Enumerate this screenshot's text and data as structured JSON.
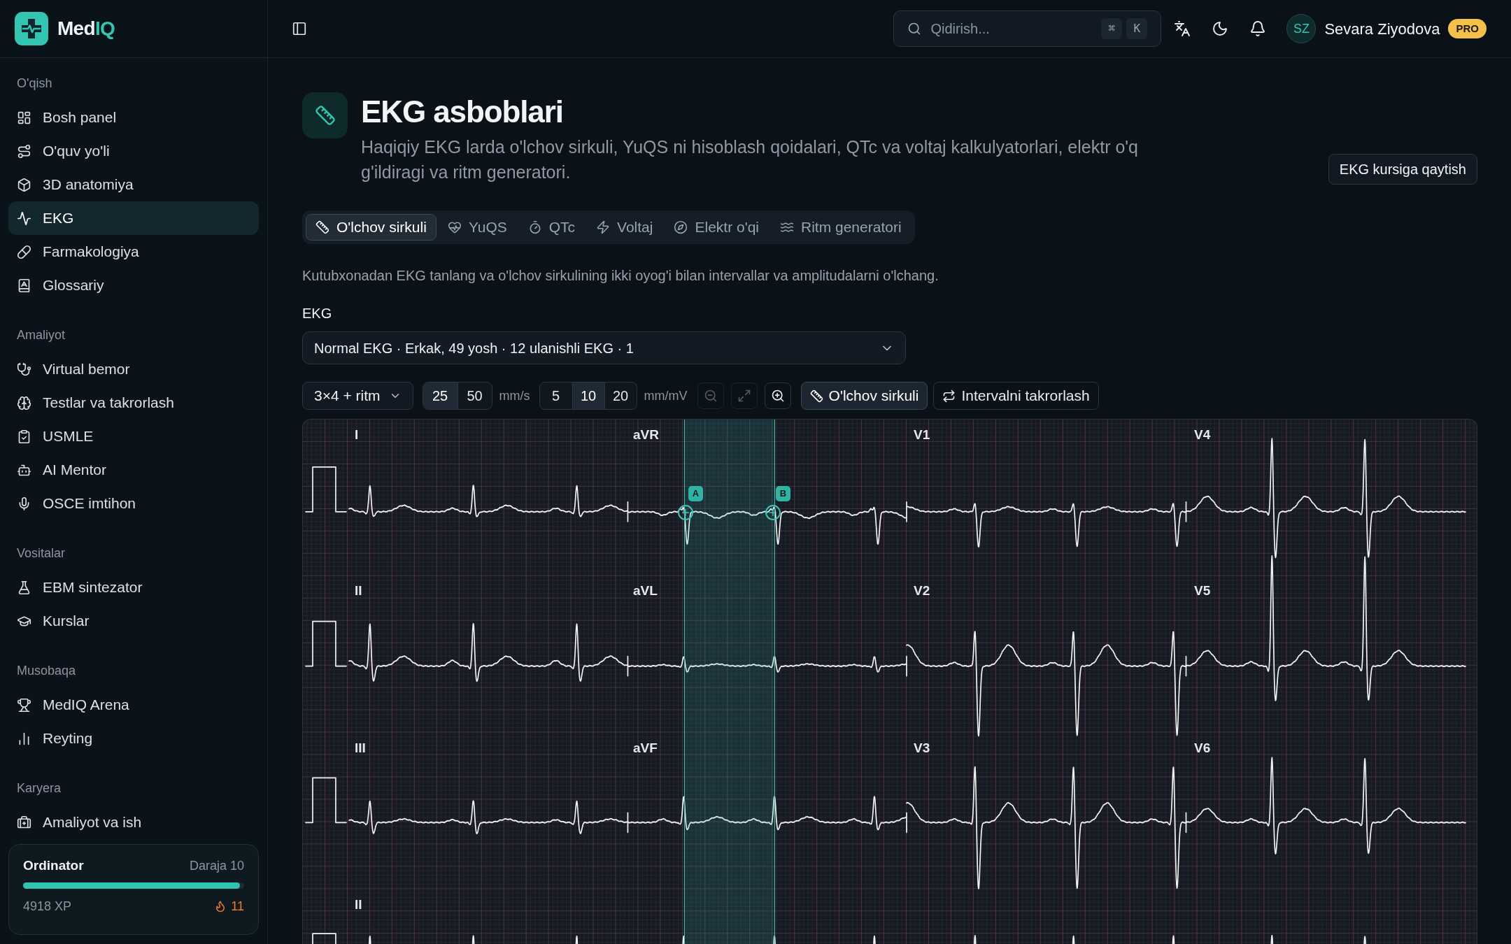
{
  "sidebar": {
    "logo": {
      "name": "Med",
      "accent": "IQ"
    },
    "sections": [
      {
        "title": "O'qish",
        "items": [
          {
            "label": "Bosh panel",
            "selected": false
          },
          {
            "label": "O'quv yo'li",
            "selected": false
          },
          {
            "label": "3D anatomiya",
            "selected": false
          },
          {
            "label": "EKG",
            "selected": true
          },
          {
            "label": "Farmakologiya",
            "selected": false
          },
          {
            "label": "Glossariy",
            "selected": false
          }
        ]
      },
      {
        "title": "Amaliyot",
        "items": [
          {
            "label": "Virtual bemor",
            "selected": false
          },
          {
            "label": "Testlar va takrorlash",
            "selected": false
          },
          {
            "label": "USMLE",
            "selected": false
          },
          {
            "label": "AI Mentor",
            "selected": false
          },
          {
            "label": "OSCE imtihon",
            "selected": false
          }
        ]
      },
      {
        "title": "Vositalar",
        "items": [
          {
            "label": "EBM sintezator",
            "selected": false
          },
          {
            "label": "Kurslar",
            "selected": false
          }
        ]
      },
      {
        "title": "Musobaqa",
        "items": [
          {
            "label": "MedIQ Arena",
            "selected": false
          },
          {
            "label": "Reyting",
            "selected": false
          }
        ]
      },
      {
        "title": "Karyera",
        "items": [
          {
            "label": "Amaliyot va ish",
            "selected": false
          }
        ]
      }
    ],
    "progress_card": {
      "title": "Ordinator",
      "rank": "Daraja 10",
      "level": 0.98,
      "xp": "4918 XP",
      "streak": "11"
    }
  },
  "top_bar": {
    "search": {
      "placeholder": "Qidirish...",
      "shortcut": [
        "⌘",
        "K"
      ]
    },
    "user": {
      "initials": "SZ",
      "name": "Sevara Ziyodova",
      "badge": "PRO"
    }
  },
  "header": {
    "title": "EKG asboblari",
    "description": "Haqiqiy EKG larda o'lchov sirkuli, YuQS ni hisoblash qoidalari, QTc va voltaj kalkulyatorlari, elektr o'q g'ildiragi va ritm generatori.",
    "back_button": "EKG kursiga qaytish"
  },
  "tabs": [
    {
      "label": "O'lchov sirkuli",
      "selected": true
    },
    {
      "label": "YuQS",
      "selected": false
    },
    {
      "label": "QTc",
      "selected": false
    },
    {
      "label": "Voltaj",
      "selected": false
    },
    {
      "label": "Elektr o'qi",
      "selected": false
    },
    {
      "label": "Ritm generatori",
      "selected": false
    }
  ],
  "instruction": "Kutubxonadan EKG tanlang va o'lchov sirkulining ikki oyog'i bilan intervallar va amplitudalarni o'lchang.",
  "ecg_select": {
    "label": "EKG",
    "value": "Normal EKG · Erkak, 49 yosh · 12 ulanishli EKG · 1"
  },
  "toolbar": {
    "layout": "3×4 + ritm",
    "speed": {
      "options": [
        {
          "label": "25",
          "selected": true
        },
        {
          "label": "50",
          "selected": false
        }
      ],
      "unit": "mm/s"
    },
    "gain": {
      "options": [
        {
          "label": "5",
          "selected": false
        },
        {
          "label": "10",
          "selected": true
        },
        {
          "label": "20",
          "selected": false
        }
      ],
      "unit": "mm/mV"
    },
    "zoom_controls": [
      {
        "kind": "zoom_out",
        "disabled": true
      },
      {
        "kind": "fit",
        "disabled": true
      },
      {
        "kind": "zoom_in",
        "disabled": false
      }
    ],
    "tools": [
      {
        "label": "O'lchov sirkuli",
        "selected": true
      },
      {
        "label": "Intervalni takrorlash",
        "selected": false
      }
    ]
  },
  "ecg": {
    "rows": [
      [
        "I",
        "aVR",
        "V1",
        "V4"
      ],
      [
        "II",
        "aVL",
        "V2",
        "V5"
      ],
      [
        "III",
        "aVF",
        "V3",
        "V6"
      ],
      [
        "II"
      ]
    ],
    "calipers": [
      "A",
      "B"
    ]
  }
}
